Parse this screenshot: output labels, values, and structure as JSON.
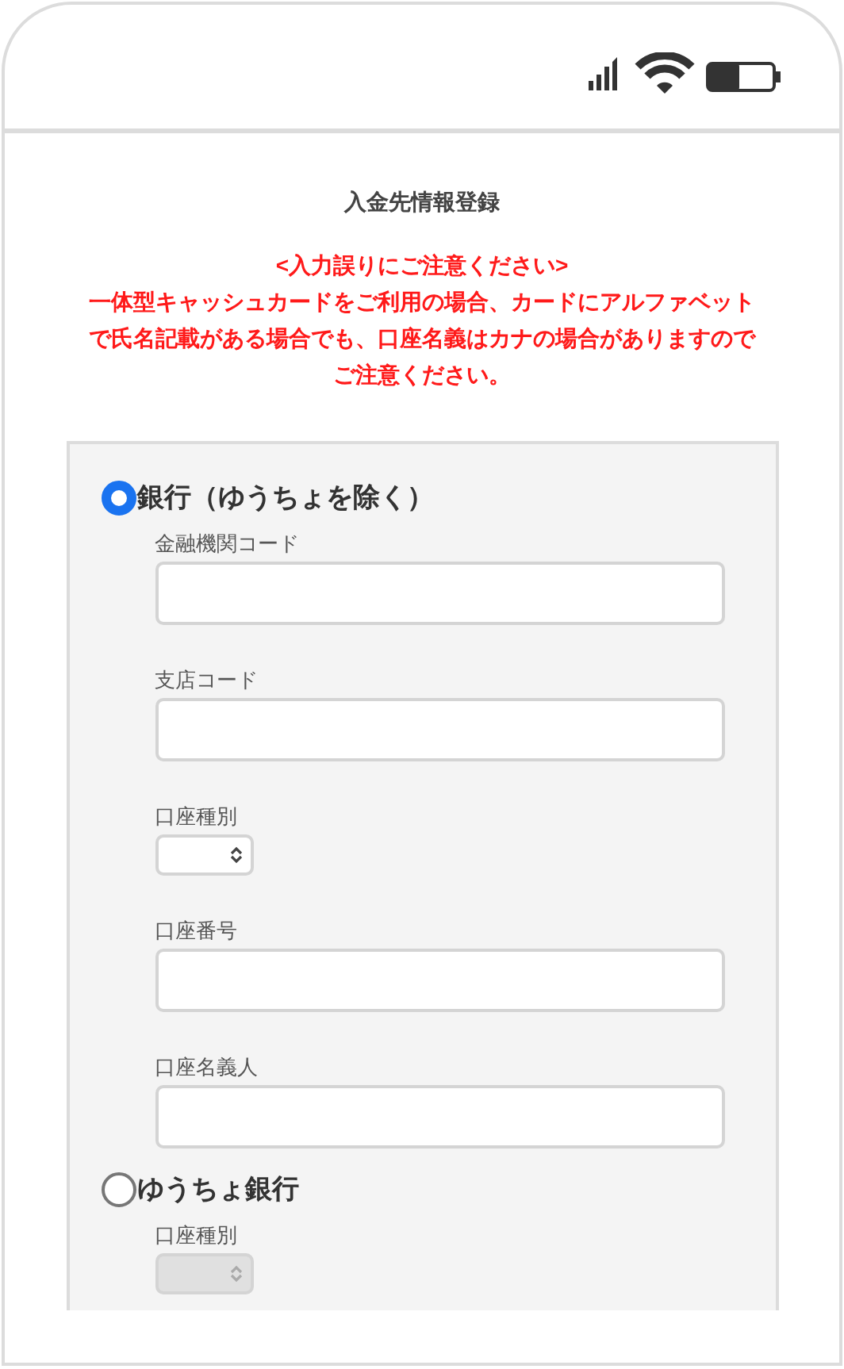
{
  "title": "入金先情報登録",
  "notice": {
    "heading": "<入力誤りにご注意ください>",
    "body": "一体型キャッシュカードをご利用の場合、カードにアルファベットで氏名記載がある場合でも、口座名義はカナの場合がありますのでご注意ください。"
  },
  "options": [
    {
      "label": "銀行（ゆうちょを除く）",
      "selected": true,
      "fields": [
        {
          "kind": "text",
          "label": "金融機関コード",
          "disabled": false
        },
        {
          "kind": "text",
          "label": "支店コード",
          "disabled": false
        },
        {
          "kind": "select",
          "label": "口座種別",
          "disabled": false
        },
        {
          "kind": "text",
          "label": "口座番号",
          "disabled": false
        },
        {
          "kind": "text",
          "label": "口座名義人",
          "disabled": false
        }
      ]
    },
    {
      "label": "ゆうちょ銀行",
      "selected": false,
      "fields": [
        {
          "kind": "select",
          "label": "口座種別",
          "disabled": true
        }
      ]
    }
  ]
}
